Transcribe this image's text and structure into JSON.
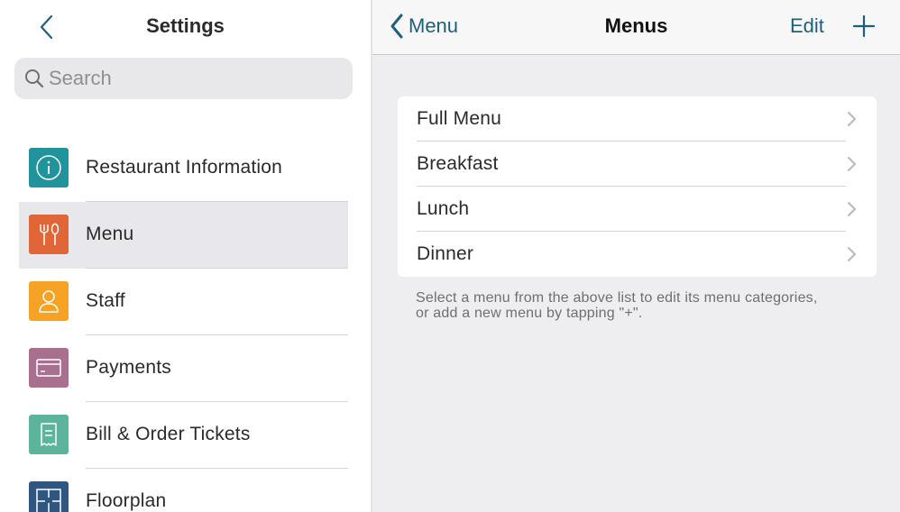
{
  "settings_pane": {
    "title": "Settings",
    "search": {
      "placeholder": "Search",
      "value": ""
    },
    "items": [
      {
        "label": "Restaurant Information",
        "icon": "info-icon",
        "color": "#20939c",
        "selected": false
      },
      {
        "label": "Menu",
        "icon": "fork-knife-icon",
        "color": "#e06637",
        "selected": true
      },
      {
        "label": "Staff",
        "icon": "person-icon",
        "color": "#f6a325",
        "selected": false
      },
      {
        "label": "Payments",
        "icon": "card-icon",
        "color": "#a8708e",
        "selected": false
      },
      {
        "label": "Bill & Order Tickets",
        "icon": "receipt-icon",
        "color": "#5bb49b",
        "selected": false
      },
      {
        "label": "Floorplan",
        "icon": "floorplan-icon",
        "color": "#2f5581",
        "selected": false
      }
    ]
  },
  "detail_pane": {
    "back_label": "Menu",
    "title": "Menus",
    "edit_label": "Edit",
    "menus": [
      "Full Menu",
      "Breakfast",
      "Lunch",
      "Dinner"
    ],
    "hint_line1": "Select a menu from the above list to edit its menu categories,",
    "hint_line2": "or add a new menu by tapping \"+\"."
  },
  "colors": {
    "accent": "#1e5f7d",
    "pane_background": "#eeeef1",
    "selected_row": "#e8e8ec"
  }
}
